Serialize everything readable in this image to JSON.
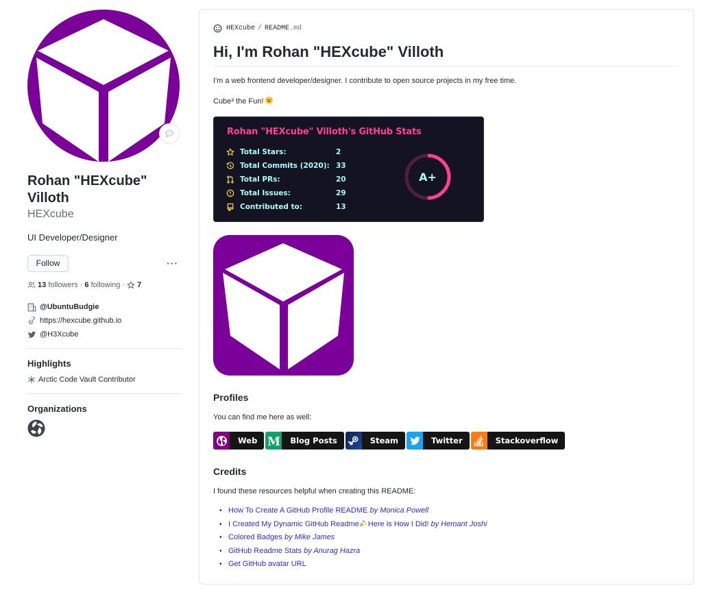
{
  "profile": {
    "full_name": "Rohan \"HEXcube\" Villoth",
    "username": "HEXcube",
    "bio": "UI Developer/Designer",
    "follow_label": "Follow",
    "more_label": "···",
    "followers_count": "13",
    "followers_label": "followers",
    "following_count": "6",
    "following_label": "following",
    "stars_count": "7",
    "separator": "·",
    "details": {
      "organization": "@UbuntuBudgie",
      "website": "https://hexcube.github.io",
      "twitter": "@H3Xcube"
    },
    "highlights_heading": "Highlights",
    "highlights": [
      "Arctic Code Vault Contributor"
    ],
    "organizations_heading": "Organizations",
    "colors": {
      "avatar_purple": "#7b0099"
    }
  },
  "readme": {
    "breadcrumb": {
      "owner": "HEXcube",
      "separator": "/",
      "file": "README",
      "ext": ".md"
    },
    "heading": "Hi, I'm Rohan \"HEXcube\" Villoth",
    "intro": "I'm a web frontend developer/designer. I contribute to open source projects in my free time.",
    "tagline": "Cube³ the Fun!",
    "stats_card": {
      "title": "Rohan \"HEXcube\" Villoth's GitHub Stats",
      "rows": [
        {
          "icon": "star-icon",
          "label": "Total Stars:",
          "value": "2"
        },
        {
          "icon": "history-icon",
          "label": "Total Commits (2020):",
          "value": "33"
        },
        {
          "icon": "pull-request-icon",
          "label": "Total PRs:",
          "value": "20"
        },
        {
          "icon": "issue-icon",
          "label": "Total Issues:",
          "value": "29"
        },
        {
          "icon": "repo-icon",
          "label": "Contributed to:",
          "value": "13"
        }
      ],
      "grade": "A+",
      "grade_progress": 0.5,
      "colors": {
        "bg": "#141321",
        "title": "#fe428e",
        "text": "#a9fef7",
        "icon": "#f8d847",
        "ring": "#fe428e"
      }
    },
    "profiles_heading": "Profiles",
    "profiles_text": "You can find me here as well:",
    "badges": [
      {
        "icon": "globe-icon",
        "label": "Web",
        "color": "#800080"
      },
      {
        "icon": "medium-icon",
        "label": "Blog Posts",
        "color": "#12a06c"
      },
      {
        "icon": "steam-icon",
        "label": "Steam",
        "color": "#1b3b7a"
      },
      {
        "icon": "twitter-icon",
        "label": "Twitter",
        "color": "#1da1f2"
      },
      {
        "icon": "stackoverflow-icon",
        "label": "Stackoverflow",
        "color": "#fe7a16"
      }
    ],
    "credits_heading": "Credits",
    "credits_text": "I found these resources helpful when creating this README:",
    "credits": [
      {
        "title": "How To Create A GitHub Profile README",
        "author": "by Monica Powell"
      },
      {
        "title": "I Created My Dynamic GitHub Readme",
        "title_suffix": " Here is How I Did!",
        "author": "by Hemant Joshi"
      },
      {
        "title": "Colored Badges",
        "author": "by Mike James"
      },
      {
        "title": "GitHub Readme Stats",
        "author": "by Anurag Hazra"
      },
      {
        "title": "Get GitHub avatar URL",
        "author": ""
      }
    ]
  }
}
